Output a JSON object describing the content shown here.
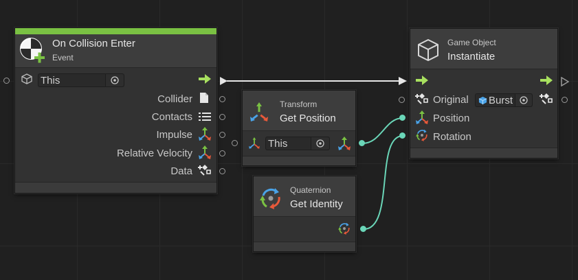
{
  "graph": {
    "nodes": {
      "collision": {
        "title": "On Collision Enter",
        "subtitle": "Event",
        "header_color": "#7ac143",
        "target_field": "This",
        "outputs": [
          {
            "label": "Collider",
            "icon": "file-icon"
          },
          {
            "label": "Contacts",
            "icon": "list-icon"
          },
          {
            "label": "Impulse",
            "icon": "vector3-icon"
          },
          {
            "label": "Relative Velocity",
            "icon": "vector3-icon"
          },
          {
            "label": "Data",
            "icon": "object-icon"
          }
        ]
      },
      "get_position": {
        "kind": "Transform",
        "title": "Get Position",
        "target_field": "This"
      },
      "get_identity": {
        "kind": "Quaternion",
        "title": "Get Identity"
      },
      "instantiate": {
        "kind": "Game Object",
        "title": "Instantiate",
        "inputs": [
          {
            "label": "Original",
            "value": "Burst"
          },
          {
            "label": "Position"
          },
          {
            "label": "Rotation"
          }
        ]
      }
    },
    "colors": {
      "flow_arrow": "#a8e05f",
      "value_connection": "#6ad6b8",
      "flow_connection": "#e8e8e8"
    }
  }
}
